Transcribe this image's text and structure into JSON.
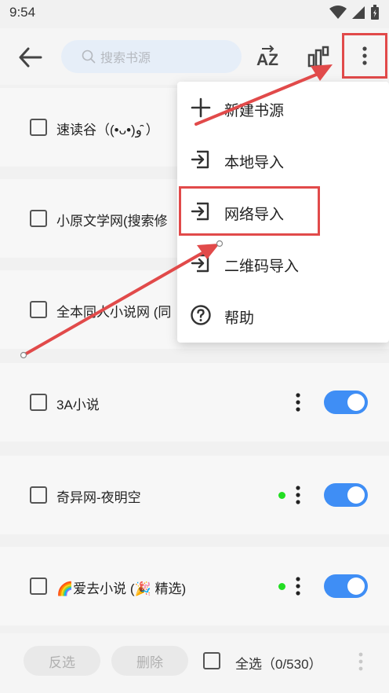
{
  "status_bar": {
    "time": "9:54"
  },
  "toolbar": {
    "search_placeholder": "搜索书源",
    "sort_label": "AZ"
  },
  "rows": [
    {
      "label": "速读谷（(•ᴗ•)و ̑̑）",
      "has_dot": false,
      "toggle_on": true
    },
    {
      "label": "小原文学网(搜索修",
      "has_dot": false,
      "toggle_on": true
    },
    {
      "label": "全本同人小说网 (同",
      "has_dot": false,
      "toggle_on": true
    },
    {
      "label": "3A小说",
      "has_dot": false,
      "toggle_on": true
    },
    {
      "label": "奇异网-夜明空",
      "has_dot": true,
      "toggle_on": true
    },
    {
      "label": "🌈爱去小说 (🎉 精选)",
      "has_dot": true,
      "toggle_on": true
    }
  ],
  "dropdown": {
    "items": [
      {
        "label": "新建书源",
        "icon": "plus-icon"
      },
      {
        "label": "本地导入",
        "icon": "import-icon"
      },
      {
        "label": "网络导入",
        "icon": "import-icon"
      },
      {
        "label": "二维码导入",
        "icon": "import-icon"
      },
      {
        "label": "帮助",
        "icon": "help-icon"
      }
    ]
  },
  "bottom_bar": {
    "invert_label": "反选",
    "delete_label": "删除",
    "select_all_label": "全选（0/530）"
  },
  "colors": {
    "accent": "#3f8ef5",
    "annotation": "#e14a4a",
    "status_dot": "#22dd22"
  }
}
